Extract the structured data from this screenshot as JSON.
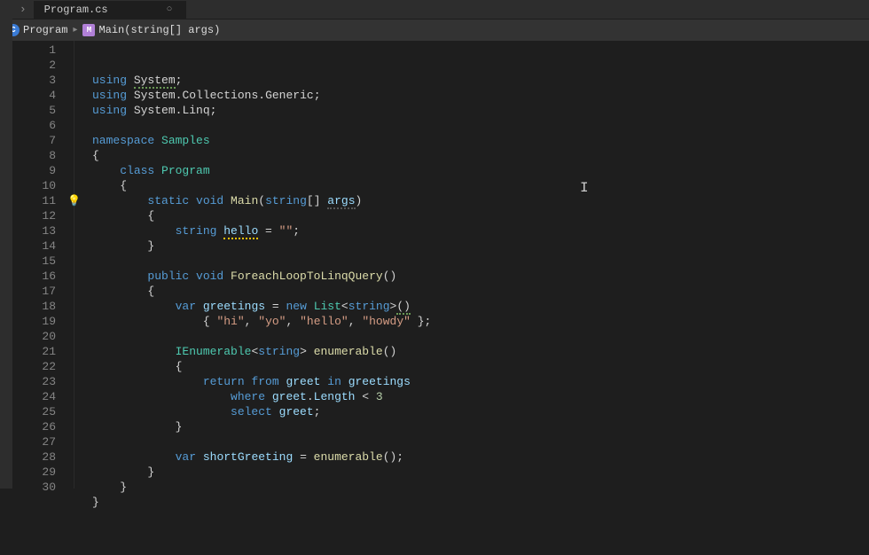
{
  "tab": {
    "title": "Program.cs",
    "dirty_marker": "○"
  },
  "nav": {
    "back": "‹",
    "forward": "›"
  },
  "breadcrumb": {
    "class_icon_letter": "C",
    "class_name": "Program",
    "sep": "▸",
    "method_icon_letter": "M",
    "method_name": "Main(string[] args)"
  },
  "bulb_glyph": "💡",
  "cursor_glyph": "I",
  "line_count": 30,
  "code_lines": [
    [
      {
        "t": "using ",
        "c": "kw"
      },
      {
        "t": "System",
        "c": "ns warn-green"
      },
      {
        "t": ";",
        "c": "punct"
      }
    ],
    [
      {
        "t": "using ",
        "c": "kw"
      },
      {
        "t": "System",
        "c": "ns"
      },
      {
        "t": ".",
        "c": "punct"
      },
      {
        "t": "Collections",
        "c": "ns"
      },
      {
        "t": ".",
        "c": "punct"
      },
      {
        "t": "Generic",
        "c": "ns"
      },
      {
        "t": ";",
        "c": "punct"
      }
    ],
    [
      {
        "t": "using ",
        "c": "kw"
      },
      {
        "t": "System",
        "c": "ns"
      },
      {
        "t": ".",
        "c": "punct"
      },
      {
        "t": "Linq",
        "c": "ns"
      },
      {
        "t": ";",
        "c": "punct"
      }
    ],
    [],
    [
      {
        "t": "namespace ",
        "c": "kw"
      },
      {
        "t": "Samples",
        "c": "type"
      }
    ],
    [
      {
        "t": "{",
        "c": "punct"
      }
    ],
    [
      {
        "t": "    ",
        "c": ""
      },
      {
        "t": "class ",
        "c": "kw"
      },
      {
        "t": "Program",
        "c": "type"
      }
    ],
    [
      {
        "t": "    {",
        "c": "punct"
      }
    ],
    [
      {
        "t": "        ",
        "c": ""
      },
      {
        "t": "static ",
        "c": "kw"
      },
      {
        "t": "void ",
        "c": "kw"
      },
      {
        "t": "Main",
        "c": "method"
      },
      {
        "t": "(",
        "c": "punct"
      },
      {
        "t": "string",
        "c": "kw"
      },
      {
        "t": "[] ",
        "c": "punct"
      },
      {
        "t": "args",
        "c": "var hint"
      },
      {
        "t": ")",
        "c": "punct"
      }
    ],
    [
      {
        "t": "        {",
        "c": "punct"
      }
    ],
    [
      {
        "t": "            ",
        "c": ""
      },
      {
        "t": "string ",
        "c": "kw"
      },
      {
        "t": "hello",
        "c": "var warn-yellow"
      },
      {
        "t": " = ",
        "c": "punct"
      },
      {
        "t": "\"\"",
        "c": "str"
      },
      {
        "t": ";",
        "c": "punct"
      }
    ],
    [
      {
        "t": "        }",
        "c": "punct"
      }
    ],
    [],
    [
      {
        "t": "        ",
        "c": ""
      },
      {
        "t": "public ",
        "c": "kw"
      },
      {
        "t": "void ",
        "c": "kw"
      },
      {
        "t": "ForeachLoopToLinqQuery",
        "c": "method"
      },
      {
        "t": "()",
        "c": "punct"
      }
    ],
    [
      {
        "t": "        {",
        "c": "punct"
      }
    ],
    [
      {
        "t": "            ",
        "c": ""
      },
      {
        "t": "var ",
        "c": "kw"
      },
      {
        "t": "greetings",
        "c": "var"
      },
      {
        "t": " = ",
        "c": "punct"
      },
      {
        "t": "new ",
        "c": "kw"
      },
      {
        "t": "List",
        "c": "type"
      },
      {
        "t": "<",
        "c": "punct"
      },
      {
        "t": "string",
        "c": "kw"
      },
      {
        "t": ">",
        "c": "punct"
      },
      {
        "t": "()",
        "c": "punct warn-green"
      }
    ],
    [
      {
        "t": "                { ",
        "c": "punct"
      },
      {
        "t": "\"hi\"",
        "c": "str"
      },
      {
        "t": ", ",
        "c": "punct"
      },
      {
        "t": "\"yo\"",
        "c": "str"
      },
      {
        "t": ", ",
        "c": "punct"
      },
      {
        "t": "\"hello\"",
        "c": "str"
      },
      {
        "t": ", ",
        "c": "punct"
      },
      {
        "t": "\"howdy\"",
        "c": "str"
      },
      {
        "t": " };",
        "c": "punct"
      }
    ],
    [],
    [
      {
        "t": "            ",
        "c": ""
      },
      {
        "t": "IEnumerable",
        "c": "type"
      },
      {
        "t": "<",
        "c": "punct"
      },
      {
        "t": "string",
        "c": "kw"
      },
      {
        "t": "> ",
        "c": "punct"
      },
      {
        "t": "enumerable",
        "c": "method"
      },
      {
        "t": "()",
        "c": "punct"
      }
    ],
    [
      {
        "t": "            {",
        "c": "punct"
      }
    ],
    [
      {
        "t": "                ",
        "c": ""
      },
      {
        "t": "return ",
        "c": "kw"
      },
      {
        "t": "from ",
        "c": "kw"
      },
      {
        "t": "greet",
        "c": "var"
      },
      {
        "t": " ",
        "c": ""
      },
      {
        "t": "in ",
        "c": "kw"
      },
      {
        "t": "greetings",
        "c": "var"
      }
    ],
    [
      {
        "t": "                    ",
        "c": ""
      },
      {
        "t": "where ",
        "c": "kw"
      },
      {
        "t": "greet",
        "c": "var"
      },
      {
        "t": ".",
        "c": "punct"
      },
      {
        "t": "Length",
        "c": "var"
      },
      {
        "t": " < ",
        "c": "punct"
      },
      {
        "t": "3",
        "c": "num"
      }
    ],
    [
      {
        "t": "                    ",
        "c": ""
      },
      {
        "t": "select ",
        "c": "kw"
      },
      {
        "t": "greet",
        "c": "var"
      },
      {
        "t": ";",
        "c": "punct"
      }
    ],
    [
      {
        "t": "            }",
        "c": "punct"
      }
    ],
    [],
    [
      {
        "t": "            ",
        "c": ""
      },
      {
        "t": "var ",
        "c": "kw"
      },
      {
        "t": "shortGreeting",
        "c": "var"
      },
      {
        "t": " = ",
        "c": "punct"
      },
      {
        "t": "enumerable",
        "c": "method"
      },
      {
        "t": "();",
        "c": "punct"
      }
    ],
    [
      {
        "t": "        }",
        "c": "punct"
      }
    ],
    [
      {
        "t": "    }",
        "c": "punct"
      }
    ],
    [
      {
        "t": "}",
        "c": "punct"
      }
    ],
    []
  ]
}
